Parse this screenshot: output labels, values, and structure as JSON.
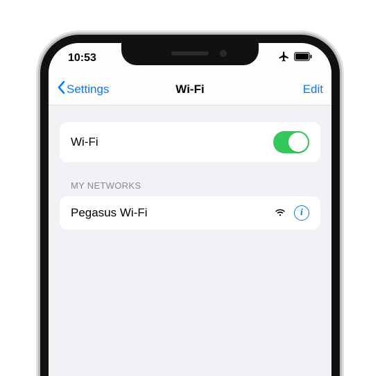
{
  "status": {
    "time": "10:53"
  },
  "nav": {
    "back_label": "Settings",
    "title": "Wi-Fi",
    "edit_label": "Edit"
  },
  "wifi_toggle": {
    "label": "Wi-Fi",
    "on": true
  },
  "sections": {
    "my_networks": {
      "header": "MY NETWORKS",
      "items": [
        {
          "name": "Pegasus Wi-Fi"
        }
      ]
    }
  }
}
